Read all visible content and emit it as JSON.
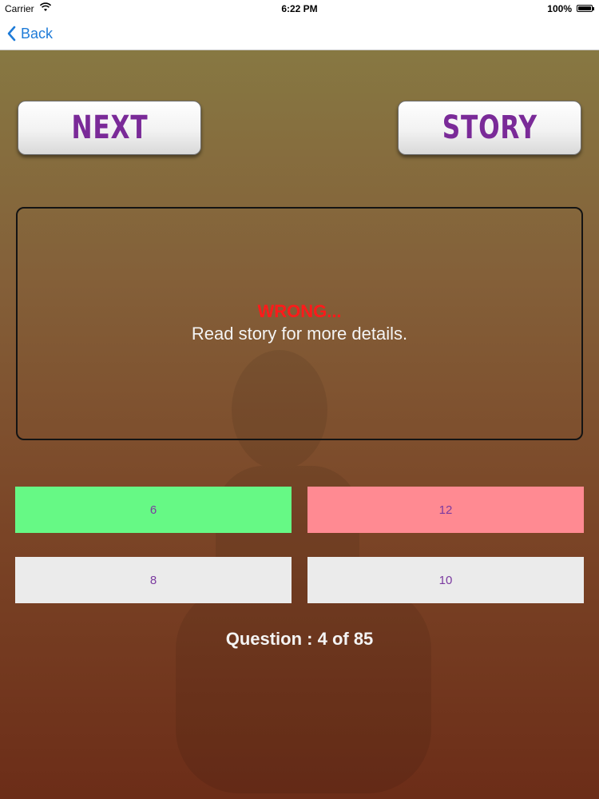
{
  "status_bar": {
    "carrier": "Carrier",
    "time": "6:22 PM",
    "battery": "100%",
    "wifi_icon": "wifi-icon",
    "battery_icon": "battery-icon"
  },
  "nav": {
    "back_label": "Back",
    "back_icon": "chevron-left-icon"
  },
  "buttons": {
    "next_label": "NEXT",
    "story_label": "STORY"
  },
  "message": {
    "title": "WRONG...",
    "detail": "Read story for more details."
  },
  "answers": [
    {
      "label": "6",
      "state": "correct",
      "color": "#66f985"
    },
    {
      "label": "12",
      "state": "wrong",
      "color": "#ff8a92"
    },
    {
      "label": "8",
      "state": "neutral",
      "color": "#ebebeb"
    },
    {
      "label": "10",
      "state": "neutral",
      "color": "#ebebeb"
    }
  ],
  "counter": {
    "text": "Question : 4 of 85"
  },
  "colors": {
    "accent": "#1e7bd8",
    "button_text": "#7a2a98",
    "wrong_text": "#ff1a1a",
    "correct_answer": "#66f985",
    "wrong_answer": "#ff8a92",
    "neutral_answer": "#ebebeb"
  }
}
